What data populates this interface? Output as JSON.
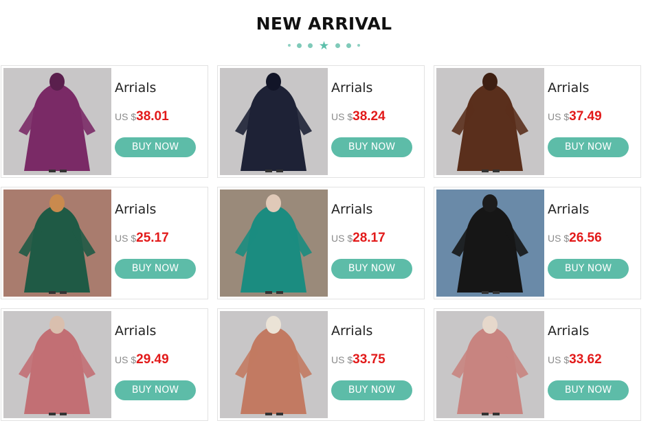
{
  "header": {
    "title": "NEW ARRIVAL",
    "divider_icon": "star-icon",
    "accent_color": "#5dbca8"
  },
  "products": [
    {
      "name": "Arrials",
      "currency": "US $",
      "price": "38.01",
      "button": "BUY NOW",
      "colors": {
        "bg": "#c8c6c7",
        "dress": "#7a2a66",
        "face": "#5a1f4d"
      }
    },
    {
      "name": "Arrials",
      "currency": "US $",
      "price": "38.24",
      "button": "BUY NOW",
      "colors": {
        "bg": "#c8c6c7",
        "dress": "#1e2236",
        "face": "#121528"
      }
    },
    {
      "name": "Arrials",
      "currency": "US $",
      "price": "37.49",
      "button": "BUY NOW",
      "colors": {
        "bg": "#c8c6c7",
        "dress": "#5a2f1c",
        "face": "#3e1f12"
      }
    },
    {
      "name": "Arrials",
      "currency": "US $",
      "price": "25.17",
      "button": "BUY NOW",
      "colors": {
        "bg": "#a97c6e",
        "dress": "#1f5a45",
        "face": "#c98a4e"
      }
    },
    {
      "name": "Arrials",
      "currency": "US $",
      "price": "28.17",
      "button": "BUY NOW",
      "colors": {
        "bg": "#9a8a7a",
        "dress": "#1b8c80",
        "face": "#e0c9b8"
      }
    },
    {
      "name": "Arrials",
      "currency": "US $",
      "price": "26.56",
      "button": "BUY NOW",
      "colors": {
        "bg": "#6a8aa8",
        "dress": "#161616",
        "face": "#1c1c1c"
      }
    },
    {
      "name": "Arrials",
      "currency": "US $",
      "price": "29.49",
      "button": "BUY NOW",
      "colors": {
        "bg": "#c8c6c7",
        "dress": "#c26f74",
        "face": "#d9bfae"
      }
    },
    {
      "name": "Arrials",
      "currency": "US $",
      "price": "33.75",
      "button": "BUY NOW",
      "colors": {
        "bg": "#c8c6c7",
        "dress": "#c27a62",
        "face": "#ebe3d6"
      }
    },
    {
      "name": "Arrials",
      "currency": "US $",
      "price": "33.62",
      "button": "BUY NOW",
      "colors": {
        "bg": "#c8c6c7",
        "dress": "#c88480",
        "face": "#e6d8cb"
      }
    }
  ]
}
